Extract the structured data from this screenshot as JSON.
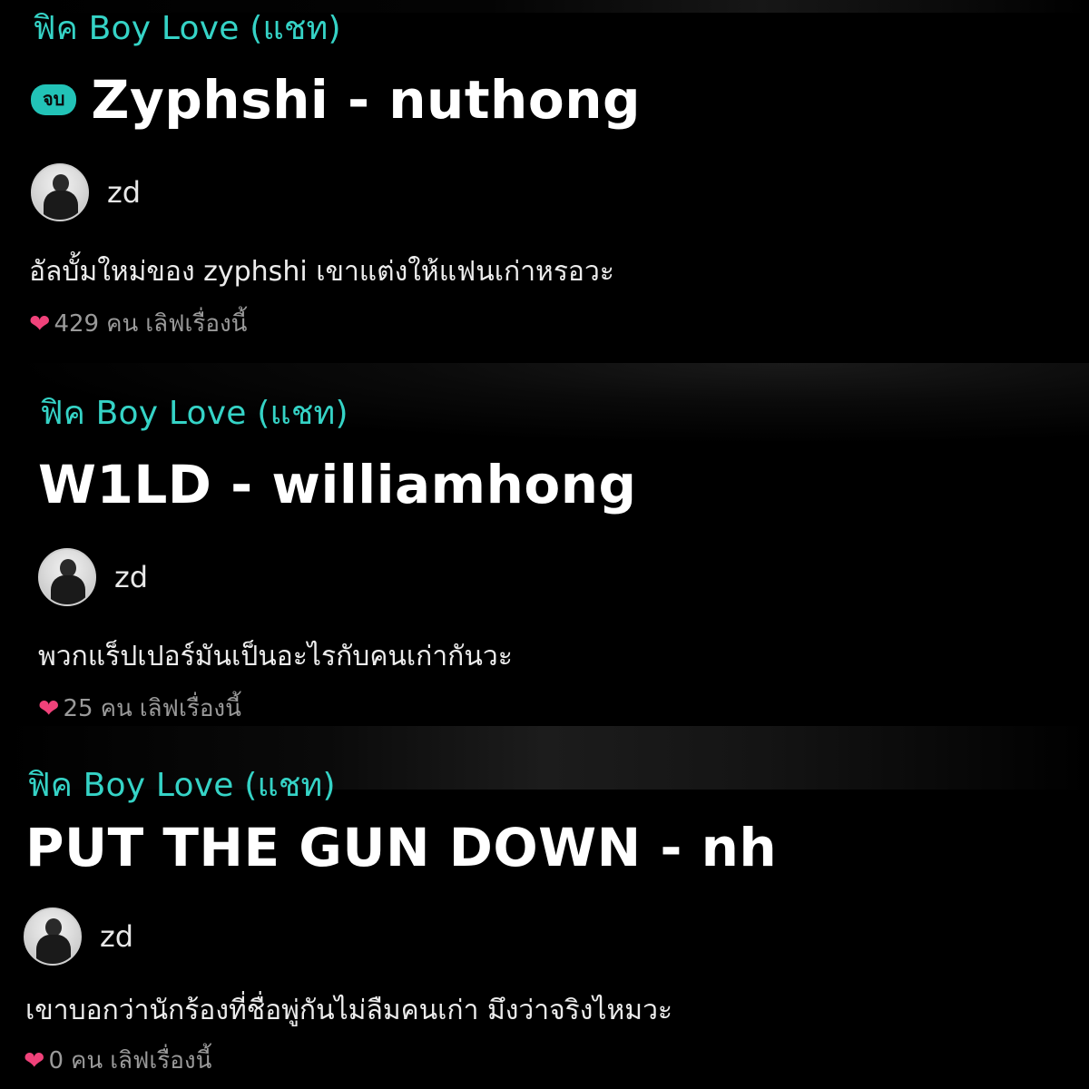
{
  "stories": [
    {
      "category": "ฟิค Boy Love (แชท)",
      "badge": "จบ",
      "title": "Zyphshi - nuthong",
      "author": "zd",
      "avatar_icon": "user-avatar",
      "description": "อัลบั้มใหม่ของ zyphshi เขาแต่งให้แฟนเก่าหรอวะ",
      "likes_count": "429",
      "likes_unit": "คน",
      "likes_label": "เลิฟเรื่องนี้"
    },
    {
      "category": "ฟิค Boy Love (แชท)",
      "title": "W1LD - williamhong",
      "author": "zd",
      "avatar_icon": "user-avatar",
      "description": "พวกแร็ปเปอร์มันเป็นอะไรกับคนเก่ากันวะ",
      "likes_count": "25",
      "likes_unit": "คน",
      "likes_label": "เลิฟเรื่องนี้"
    },
    {
      "category": "ฟิค Boy Love (แชท)",
      "title": "PUT THE GUN DOWN - nh",
      "author": "zd",
      "avatar_icon": "user-avatar",
      "description": "เขาบอกว่านักร้องที่ชื่อพู่กันไม่ลืมคนเก่า มึงว่าจริงไหมวะ",
      "likes_count": "0",
      "likes_unit": "คน",
      "likes_label": "เลิฟเรื่องนี้"
    }
  ],
  "colors": {
    "background": "#000000",
    "category": "#35d3c6",
    "badge": "#22c3b7",
    "heart": "#f0427a",
    "likes_text": "#9a9a9a"
  },
  "icons": {
    "heart": "heart-icon"
  }
}
